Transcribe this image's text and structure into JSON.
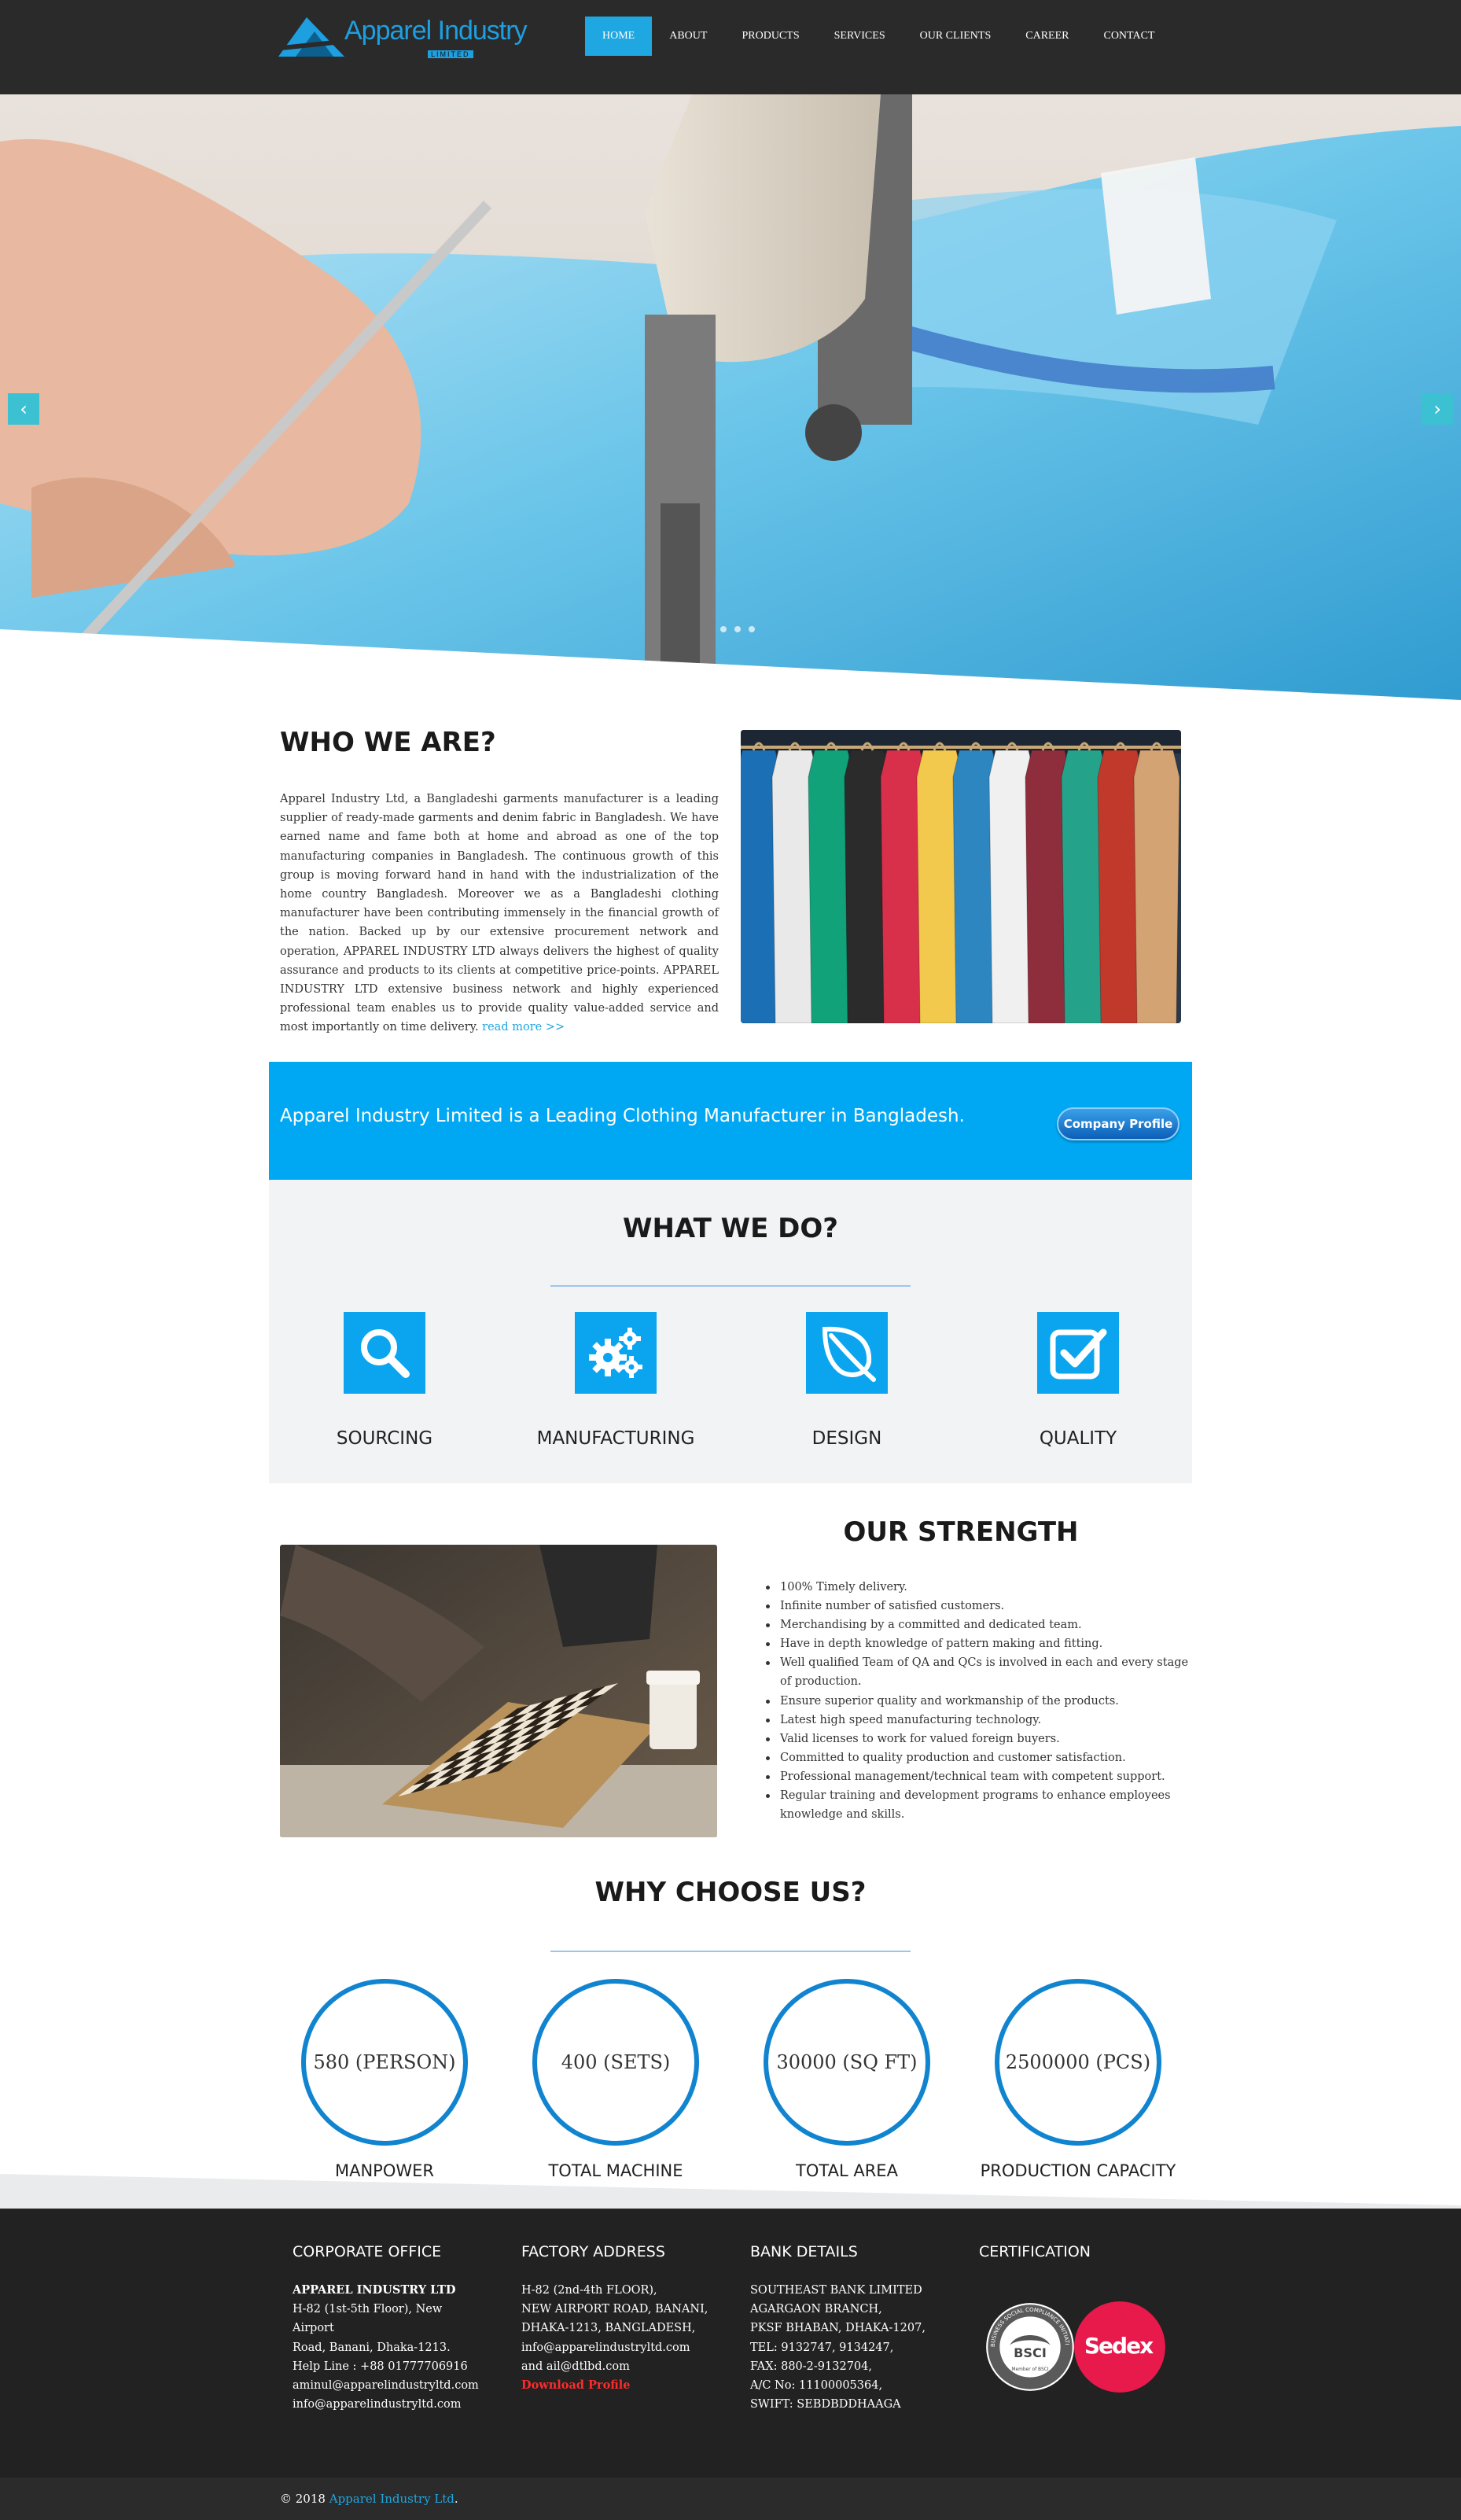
{
  "header": {
    "logo_text": "Apparel Industry",
    "logo_sub": "LIMITED",
    "nav": [
      {
        "label": "HOME",
        "active": true
      },
      {
        "label": "ABOUT"
      },
      {
        "label": "PRODUCTS"
      },
      {
        "label": "SERVICES"
      },
      {
        "label": "OUR CLIENTS"
      },
      {
        "label": "CAREER"
      },
      {
        "label": "CONTACT"
      }
    ]
  },
  "hero": {
    "prev_arrow": "‹",
    "next_arrow": "›"
  },
  "who": {
    "title": "WHO WE ARE?",
    "text": "Apparel Industry Ltd, a Bangladeshi garments manufacturer is a leading supplier of ready-made garments and denim fabric in Bangladesh. We have earned name and fame both at home and abroad as one of the top manufacturing companies in Bangladesh. The continuous growth of this group is moving forward hand in hand with the industrialization of the home country Bangladesh. Moreover we as a Bangladeshi clothing manufacturer have been contributing immensely in the financial growth of the nation. Backed up by our extensive procurement network and operation, APPAREL INDUSTRY LTD always delivers the highest of quality assurance and products to its clients at competitive price-points. APPAREL INDUSTRY LTD extensive business network and highly experienced professional team enables us to provide quality value-added service and most importantly on time delivery.",
    "read_more": "read more >>"
  },
  "banner": {
    "text": "Apparel Industry Limited is a Leading Clothing Manufacturer in Bangladesh.",
    "button": "Company Profile"
  },
  "whatdo": {
    "title": "WHAT WE DO?",
    "items": [
      {
        "label": "SOURCING",
        "icon": "search-icon"
      },
      {
        "label": "MANUFACTURING",
        "icon": "gears-icon"
      },
      {
        "label": "DESIGN",
        "icon": "leaf-icon"
      },
      {
        "label": "QUALITY",
        "icon": "checkbox-icon"
      }
    ]
  },
  "strength": {
    "title": "OUR STRENGTH",
    "items": [
      "100% Timely delivery.",
      "Infinite number of satisfied customers.",
      "Merchandising by a committed and dedicated team.",
      "Have in depth knowledge of pattern making and fitting.",
      "Well qualified Team of QA and QCs is involved in each and every stage of production.",
      "Ensure superior quality and workmanship of the products.",
      "Latest high speed manufacturing technology.",
      "Valid licenses to work for valued foreign buyers.",
      "Committed to quality production and customer satisfaction.",
      "Professional management/technical team with competent support.",
      "Regular training and development programs to enhance employees knowledge and skills."
    ]
  },
  "why": {
    "title": "WHY CHOOSE US?",
    "stats": [
      {
        "value": "580 (PERSON)",
        "label": "MANPOWER"
      },
      {
        "value": "400 (SETS)",
        "label": "TOTAL MACHINE"
      },
      {
        "value": "30000 (SQ FT)",
        "label": "TOTAL AREA"
      },
      {
        "value": "2500000 (PCS)",
        "label": "PRODUCTION CAPACITY"
      }
    ]
  },
  "footer": {
    "corporate": {
      "title": "CORPORATE OFFICE",
      "lines": [
        "APPAREL INDUSTRY LTD",
        "H-82 (1st-5th Floor), New",
        "Airport",
        "Road, Banani, Dhaka-1213.",
        "Help Line : +88 01777706916",
        "aminul@apparelindustryltd.com",
        "info@apparelindustryltd.com"
      ]
    },
    "factory": {
      "title": "FACTORY ADDRESS",
      "lines": [
        "H-82 (2nd-4th FLOOR),",
        "NEW AIRPORT ROAD, BANANI,",
        "DHAKA-1213, BANGLADESH,",
        "info@apparelindustryltd.com",
        "and ail@dtlbd.com"
      ],
      "download": "Download Profile"
    },
    "bank": {
      "title": "BANK DETAILS",
      "lines": [
        "SOUTHEAST BANK LIMITED",
        "AGARGAON BRANCH,",
        "PKSF BHABAN, DHAKA-1207,",
        "TEL: 9132747, 9134247,",
        "FAX: 880-2-9132704,",
        "A/C No: 11100005364,",
        "SWIFT: SEBDBDDHAAGA"
      ]
    },
    "certification": {
      "title": "CERTIFICATION",
      "bsci": "BSCI",
      "bsci_ring": "BUSINESS SOCIAL COMPLIANCE INITIATIVE",
      "bsci_member": "Member of BSCI",
      "sedex": "Sedex"
    },
    "copyright_prefix": "© 2018",
    "copyright_link": "Apparel Industry Ltd",
    "copyright_suffix": "."
  },
  "colors": {
    "accent": "#1ea7e1",
    "banner": "#00a8f3",
    "header_bg": "#2a2a2a",
    "footer_bg": "#222222",
    "circle": "#1184d0",
    "download_red": "#ff2a2a",
    "sedex_pink": "#e8194b"
  }
}
